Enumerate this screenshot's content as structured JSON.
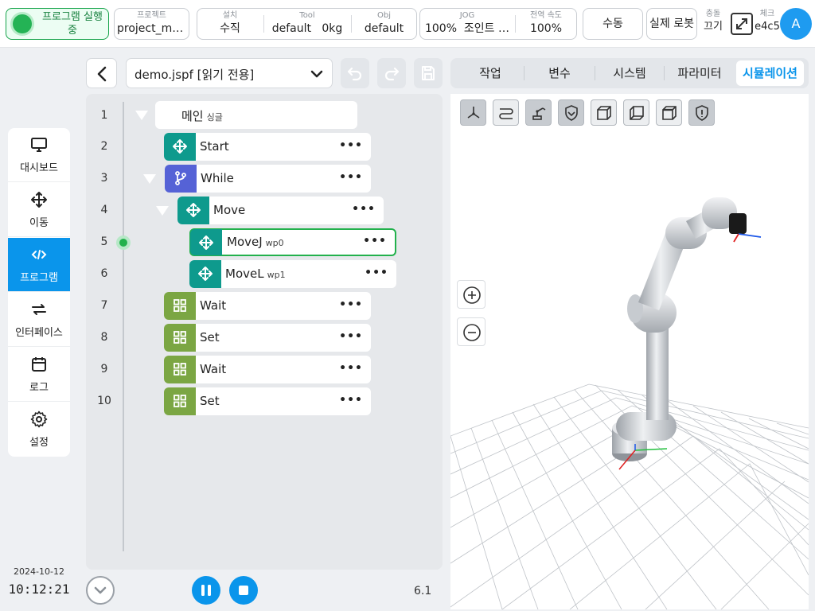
{
  "topbar": {
    "run_status": "프로그램 실행 중",
    "project": {
      "label": "프로젝트",
      "value": "project_mo…"
    },
    "install": {
      "label": "설치",
      "value": "수직"
    },
    "tool": {
      "label": "Tool",
      "value": "default",
      "payload": "0kg"
    },
    "obj": {
      "label": "Obj",
      "value": "default"
    },
    "jog": {
      "label": "JOG",
      "value": "100%",
      "mode": "조인트 …"
    },
    "global_speed": {
      "label": "전역 속도",
      "value": "100%"
    },
    "manual_button": "수동",
    "real_robot_button": "실제 로봇",
    "collision": {
      "label": "충돌",
      "value": "끄기"
    },
    "check": {
      "label": "체크",
      "value": "e4c5"
    },
    "avatar_letter": "A"
  },
  "sidebar": {
    "items": [
      {
        "label": "대시보드",
        "icon": "monitor-icon"
      },
      {
        "label": "이동",
        "icon": "move-icon"
      },
      {
        "label": "프로그램",
        "icon": "code-icon"
      },
      {
        "label": "인터페이스",
        "icon": "swap-icon"
      },
      {
        "label": "로그",
        "icon": "calendar-icon"
      },
      {
        "label": "설정",
        "icon": "gear-icon"
      }
    ],
    "active_index": 2,
    "date": "2024-10-12",
    "time": "10:12:21"
  },
  "program": {
    "file_name": "demo.jspf [읽기 전용]",
    "lines": [
      "1",
      "2",
      "3",
      "4",
      "5",
      "6",
      "7",
      "8",
      "9",
      "10"
    ],
    "main": {
      "label": "메인",
      "sub": "싱글"
    },
    "nodes": [
      {
        "label": "Start",
        "sub": ""
      },
      {
        "label": "While",
        "sub": ""
      },
      {
        "label": "Move",
        "sub": ""
      },
      {
        "label": "MoveJ",
        "sub": "wp0"
      },
      {
        "label": "MoveL",
        "sub": "wp1"
      },
      {
        "label": "Wait",
        "sub": ""
      },
      {
        "label": "Set",
        "sub": ""
      },
      {
        "label": "Wait",
        "sub": ""
      },
      {
        "label": "Set",
        "sub": ""
      }
    ],
    "more_symbol": "•••",
    "version": "6.1"
  },
  "tabs": {
    "items": [
      "작업",
      "변수",
      "시스템",
      "파라미터",
      "시뮬레이션"
    ],
    "active_index": 4
  },
  "colors": {
    "accent": "#0a95eb",
    "running": "#22b14c",
    "move_node": "#0e9a8d",
    "loop_node": "#5562d6",
    "io_node": "#7ba643"
  }
}
